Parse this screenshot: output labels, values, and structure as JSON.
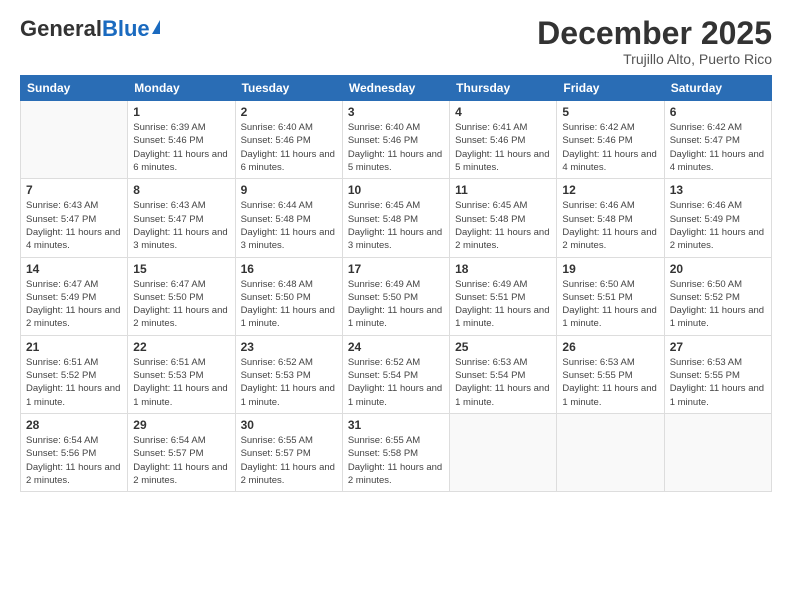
{
  "header": {
    "logo_general": "General",
    "logo_blue": "Blue",
    "month_title": "December 2025",
    "subtitle": "Trujillo Alto, Puerto Rico"
  },
  "days_of_week": [
    "Sunday",
    "Monday",
    "Tuesday",
    "Wednesday",
    "Thursday",
    "Friday",
    "Saturday"
  ],
  "weeks": [
    [
      {
        "day": "",
        "sunrise": "",
        "sunset": "",
        "daylight": ""
      },
      {
        "day": "1",
        "sunrise": "Sunrise: 6:39 AM",
        "sunset": "Sunset: 5:46 PM",
        "daylight": "Daylight: 11 hours and 6 minutes."
      },
      {
        "day": "2",
        "sunrise": "Sunrise: 6:40 AM",
        "sunset": "Sunset: 5:46 PM",
        "daylight": "Daylight: 11 hours and 6 minutes."
      },
      {
        "day": "3",
        "sunrise": "Sunrise: 6:40 AM",
        "sunset": "Sunset: 5:46 PM",
        "daylight": "Daylight: 11 hours and 5 minutes."
      },
      {
        "day": "4",
        "sunrise": "Sunrise: 6:41 AM",
        "sunset": "Sunset: 5:46 PM",
        "daylight": "Daylight: 11 hours and 5 minutes."
      },
      {
        "day": "5",
        "sunrise": "Sunrise: 6:42 AM",
        "sunset": "Sunset: 5:46 PM",
        "daylight": "Daylight: 11 hours and 4 minutes."
      },
      {
        "day": "6",
        "sunrise": "Sunrise: 6:42 AM",
        "sunset": "Sunset: 5:47 PM",
        "daylight": "Daylight: 11 hours and 4 minutes."
      }
    ],
    [
      {
        "day": "7",
        "sunrise": "Sunrise: 6:43 AM",
        "sunset": "Sunset: 5:47 PM",
        "daylight": "Daylight: 11 hours and 4 minutes."
      },
      {
        "day": "8",
        "sunrise": "Sunrise: 6:43 AM",
        "sunset": "Sunset: 5:47 PM",
        "daylight": "Daylight: 11 hours and 3 minutes."
      },
      {
        "day": "9",
        "sunrise": "Sunrise: 6:44 AM",
        "sunset": "Sunset: 5:48 PM",
        "daylight": "Daylight: 11 hours and 3 minutes."
      },
      {
        "day": "10",
        "sunrise": "Sunrise: 6:45 AM",
        "sunset": "Sunset: 5:48 PM",
        "daylight": "Daylight: 11 hours and 3 minutes."
      },
      {
        "day": "11",
        "sunrise": "Sunrise: 6:45 AM",
        "sunset": "Sunset: 5:48 PM",
        "daylight": "Daylight: 11 hours and 2 minutes."
      },
      {
        "day": "12",
        "sunrise": "Sunrise: 6:46 AM",
        "sunset": "Sunset: 5:48 PM",
        "daylight": "Daylight: 11 hours and 2 minutes."
      },
      {
        "day": "13",
        "sunrise": "Sunrise: 6:46 AM",
        "sunset": "Sunset: 5:49 PM",
        "daylight": "Daylight: 11 hours and 2 minutes."
      }
    ],
    [
      {
        "day": "14",
        "sunrise": "Sunrise: 6:47 AM",
        "sunset": "Sunset: 5:49 PM",
        "daylight": "Daylight: 11 hours and 2 minutes."
      },
      {
        "day": "15",
        "sunrise": "Sunrise: 6:47 AM",
        "sunset": "Sunset: 5:50 PM",
        "daylight": "Daylight: 11 hours and 2 minutes."
      },
      {
        "day": "16",
        "sunrise": "Sunrise: 6:48 AM",
        "sunset": "Sunset: 5:50 PM",
        "daylight": "Daylight: 11 hours and 1 minute."
      },
      {
        "day": "17",
        "sunrise": "Sunrise: 6:49 AM",
        "sunset": "Sunset: 5:50 PM",
        "daylight": "Daylight: 11 hours and 1 minute."
      },
      {
        "day": "18",
        "sunrise": "Sunrise: 6:49 AM",
        "sunset": "Sunset: 5:51 PM",
        "daylight": "Daylight: 11 hours and 1 minute."
      },
      {
        "day": "19",
        "sunrise": "Sunrise: 6:50 AM",
        "sunset": "Sunset: 5:51 PM",
        "daylight": "Daylight: 11 hours and 1 minute."
      },
      {
        "day": "20",
        "sunrise": "Sunrise: 6:50 AM",
        "sunset": "Sunset: 5:52 PM",
        "daylight": "Daylight: 11 hours and 1 minute."
      }
    ],
    [
      {
        "day": "21",
        "sunrise": "Sunrise: 6:51 AM",
        "sunset": "Sunset: 5:52 PM",
        "daylight": "Daylight: 11 hours and 1 minute."
      },
      {
        "day": "22",
        "sunrise": "Sunrise: 6:51 AM",
        "sunset": "Sunset: 5:53 PM",
        "daylight": "Daylight: 11 hours and 1 minute."
      },
      {
        "day": "23",
        "sunrise": "Sunrise: 6:52 AM",
        "sunset": "Sunset: 5:53 PM",
        "daylight": "Daylight: 11 hours and 1 minute."
      },
      {
        "day": "24",
        "sunrise": "Sunrise: 6:52 AM",
        "sunset": "Sunset: 5:54 PM",
        "daylight": "Daylight: 11 hours and 1 minute."
      },
      {
        "day": "25",
        "sunrise": "Sunrise: 6:53 AM",
        "sunset": "Sunset: 5:54 PM",
        "daylight": "Daylight: 11 hours and 1 minute."
      },
      {
        "day": "26",
        "sunrise": "Sunrise: 6:53 AM",
        "sunset": "Sunset: 5:55 PM",
        "daylight": "Daylight: 11 hours and 1 minute."
      },
      {
        "day": "27",
        "sunrise": "Sunrise: 6:53 AM",
        "sunset": "Sunset: 5:55 PM",
        "daylight": "Daylight: 11 hours and 1 minute."
      }
    ],
    [
      {
        "day": "28",
        "sunrise": "Sunrise: 6:54 AM",
        "sunset": "Sunset: 5:56 PM",
        "daylight": "Daylight: 11 hours and 2 minutes."
      },
      {
        "day": "29",
        "sunrise": "Sunrise: 6:54 AM",
        "sunset": "Sunset: 5:57 PM",
        "daylight": "Daylight: 11 hours and 2 minutes."
      },
      {
        "day": "30",
        "sunrise": "Sunrise: 6:55 AM",
        "sunset": "Sunset: 5:57 PM",
        "daylight": "Daylight: 11 hours and 2 minutes."
      },
      {
        "day": "31",
        "sunrise": "Sunrise: 6:55 AM",
        "sunset": "Sunset: 5:58 PM",
        "daylight": "Daylight: 11 hours and 2 minutes."
      },
      {
        "day": "",
        "sunrise": "",
        "sunset": "",
        "daylight": ""
      },
      {
        "day": "",
        "sunrise": "",
        "sunset": "",
        "daylight": ""
      },
      {
        "day": "",
        "sunrise": "",
        "sunset": "",
        "daylight": ""
      }
    ]
  ]
}
